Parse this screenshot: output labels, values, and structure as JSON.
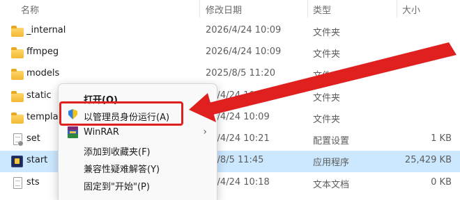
{
  "columns": {
    "name": "名称",
    "date": "修改日期",
    "type": "类型",
    "size": "大小"
  },
  "files": [
    {
      "name": "_internal",
      "date": "2026/4/24 10:09",
      "type": "文件夹",
      "size": "",
      "icon": "folder-icon"
    },
    {
      "name": "ffmpeg",
      "date": "2026/4/24 10:09",
      "type": "文件夹",
      "size": "",
      "icon": "folder-icon"
    },
    {
      "name": "models",
      "date": "2025/8/5 11:20",
      "type": "文件夹",
      "size": "",
      "icon": "folder-icon"
    },
    {
      "name": "static",
      "date": "26/4/24 10:09",
      "type": "文件夹",
      "size": "",
      "icon": "folder-icon"
    },
    {
      "name": "templa",
      "date": "26/4/24 10:09",
      "type": "文件夹",
      "size": "",
      "icon": "folder-icon"
    },
    {
      "name": "set",
      "date": "26/4/24 10:21",
      "type": "配置设置",
      "size": "1 KB",
      "icon": "settings-file-icon"
    },
    {
      "name": "start",
      "date": "25/8/5 11:45",
      "type": "应用程序",
      "size": "25,429 KB",
      "icon": "application-icon"
    },
    {
      "name": "sts",
      "date": "26/4/24 10:18",
      "type": "文本文档",
      "size": "0 KB",
      "icon": "text-file-icon"
    }
  ],
  "context_menu": {
    "items": [
      {
        "label": "打开(O)",
        "icon": "",
        "bold": true
      },
      {
        "label": "以管理员身份运行(A)",
        "icon": "uac-shield-icon"
      },
      {
        "label": "WinRAR",
        "icon": "winrar-icon",
        "submenu": true
      },
      {
        "label": "添加到收藏夹(F)",
        "icon": ""
      },
      {
        "label": "兼容性疑难解答(Y)",
        "icon": ""
      },
      {
        "label": "固定到\"开始\"(P)",
        "icon": ""
      }
    ]
  },
  "annotation": {
    "highlight_color": "#e0201f"
  },
  "colors": {
    "selected_row": "#cce8ff",
    "folder": "#f3b832"
  }
}
